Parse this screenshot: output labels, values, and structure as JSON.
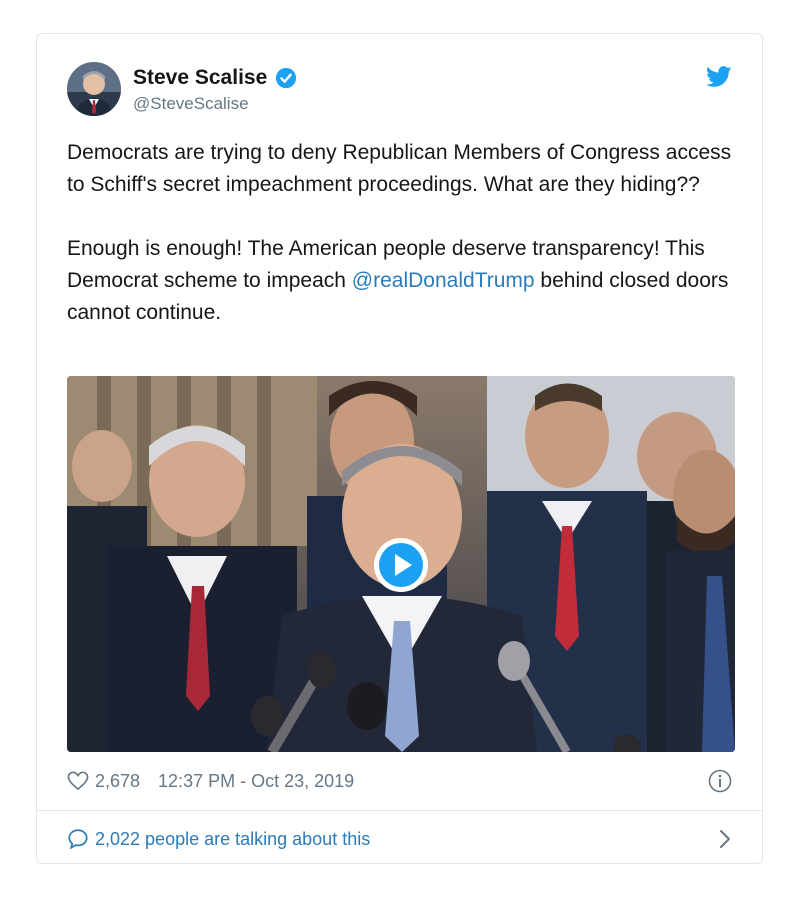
{
  "author": {
    "name": "Steve Scalise",
    "handle": "@SteveScalise",
    "verified": true,
    "avatar_icon": "person-avatar"
  },
  "tweet": {
    "text_part1": "Democrats are trying to deny Republican Members of Congress access to Schiff's secret impeachment proceedings. What are they hiding??\n\nEnough is enough! The American people deserve transparency! This Democrat scheme to impeach ",
    "mention": "@realDonaldTrump",
    "text_part2": " behind closed doors cannot continue."
  },
  "media": {
    "type": "video",
    "play_icon": "play-icon"
  },
  "meta": {
    "likes": "2,678",
    "timestamp": "12:37 PM - Oct 23, 2019"
  },
  "footer": {
    "talking": "2,022 people are talking about this"
  },
  "colors": {
    "twitter_blue": "#1da1f2",
    "link_blue": "#2b7bb9",
    "muted": "#657786",
    "border": "#e1e8ed"
  }
}
